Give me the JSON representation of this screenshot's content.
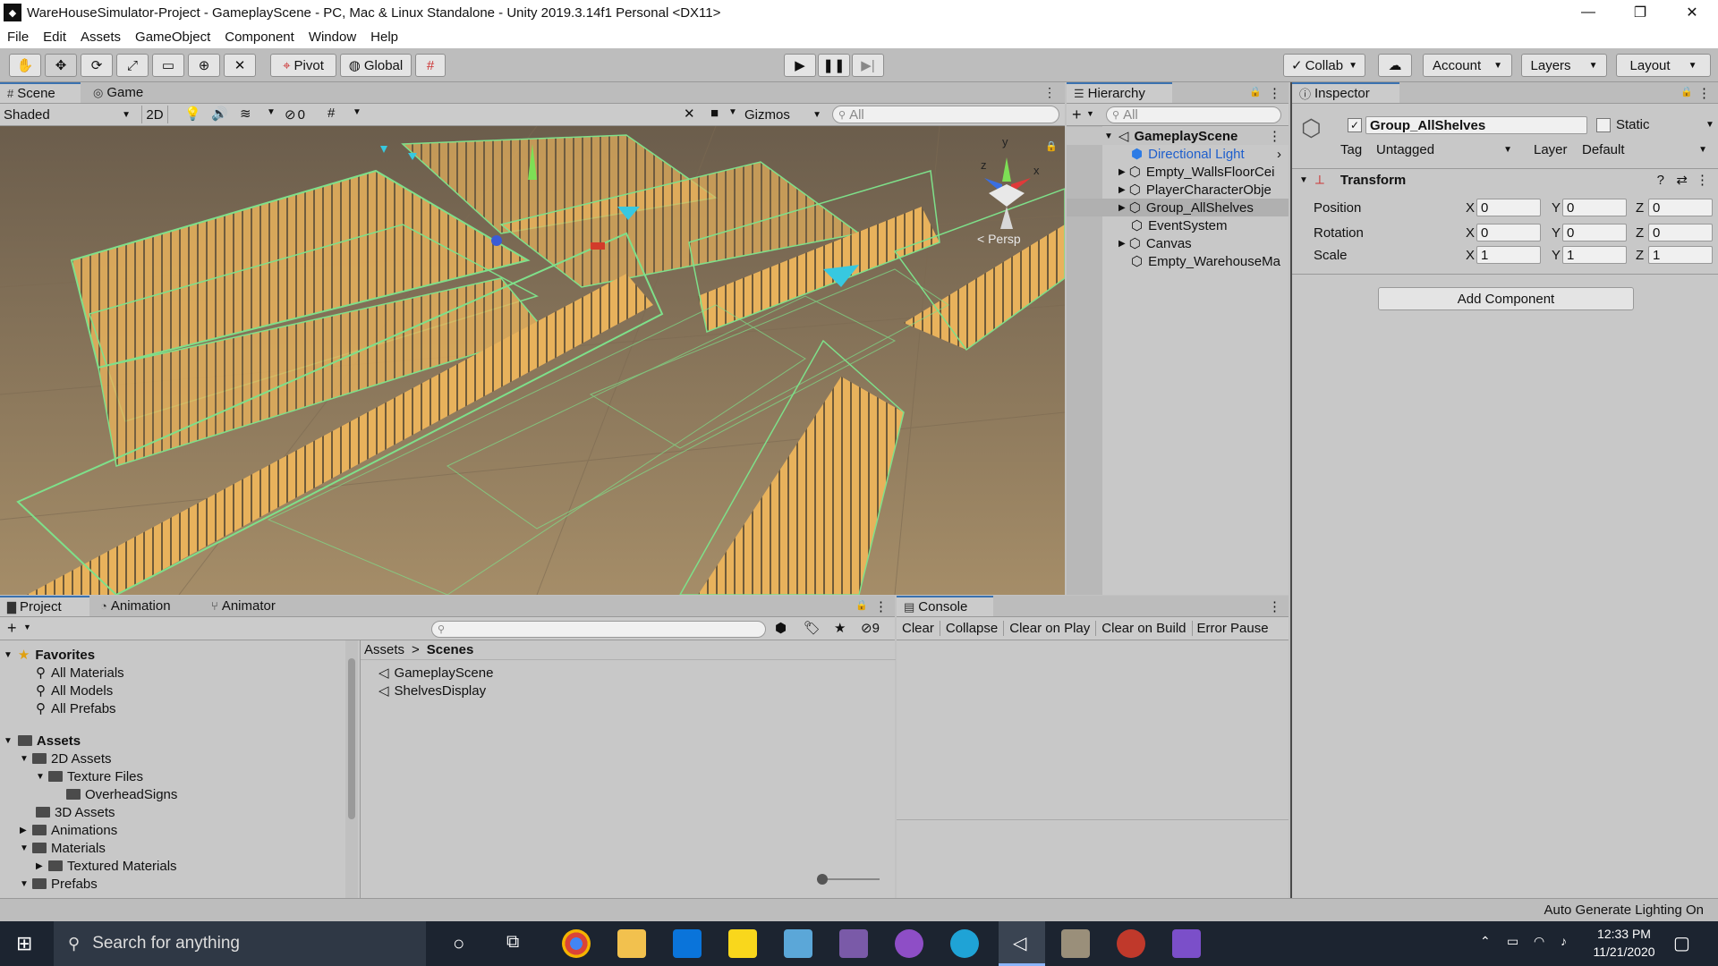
{
  "window": {
    "title": "WareHouseSimulator-Project - GameplayScene - PC, Mac & Linux Standalone - Unity 2019.3.14f1 Personal <DX11>",
    "min": "—",
    "restore": "❐",
    "close": "✕"
  },
  "menu": [
    "File",
    "Edit",
    "Assets",
    "GameObject",
    "Component",
    "Window",
    "Help"
  ],
  "toolbar": {
    "pivot": "Pivot",
    "global": "Global",
    "collab": "Collab",
    "account": "Account",
    "layers": "Layers",
    "layout": "Layout"
  },
  "scene": {
    "tab_scene": "Scene",
    "tab_game": "Game",
    "shading": "Shaded",
    "mode_2d": "2D",
    "hidden_count": "0",
    "gizmos": "Gizmos",
    "search_placeholder": "All",
    "persp": "< Persp",
    "axis_y": "y",
    "axis_x": "x",
    "axis_z": "z"
  },
  "hierarchy": {
    "title": "Hierarchy",
    "search_placeholder": "All",
    "scene_name": "GameplayScene",
    "items": [
      {
        "label": "Directional Light",
        "expandable": false,
        "selected_blue": true
      },
      {
        "label": "Empty_WallsFloorCei",
        "expandable": true
      },
      {
        "label": "PlayerCharacterObje",
        "expandable": true
      },
      {
        "label": "Group_AllShelves",
        "expandable": true,
        "selected": true
      },
      {
        "label": "EventSystem",
        "expandable": false
      },
      {
        "label": "Canvas",
        "expandable": true
      },
      {
        "label": "Empty_WarehouseMa",
        "expandable": false
      }
    ]
  },
  "inspector": {
    "title": "Inspector",
    "object_name": "Group_AllShelves",
    "static_label": "Static",
    "tag_label": "Tag",
    "tag_value": "Untagged",
    "layer_label": "Layer",
    "layer_value": "Default",
    "transform_title": "Transform",
    "position_label": "Position",
    "rotation_label": "Rotation",
    "scale_label": "Scale",
    "x": "X",
    "y": "Y",
    "z": "Z",
    "position": [
      "0",
      "0",
      "0"
    ],
    "rotation": [
      "0",
      "0",
      "0"
    ],
    "scale": [
      "1",
      "1",
      "1"
    ],
    "add_component": "Add Component"
  },
  "project": {
    "tab_project": "Project",
    "tab_animation": "Animation",
    "tab_animator": "Animator",
    "favorites": "Favorites",
    "fav_items": [
      "All Materials",
      "All Models",
      "All Prefabs"
    ],
    "assets_root": "Assets",
    "tree": [
      {
        "label": "2D Assets",
        "level": 1,
        "arrow": "▼"
      },
      {
        "label": "Texture Files",
        "level": 2,
        "arrow": "▼"
      },
      {
        "label": "OverheadSigns",
        "level": 3,
        "arrow": ""
      },
      {
        "label": "3D Assets",
        "level": 1,
        "arrow": ""
      },
      {
        "label": "Animations",
        "level": 1,
        "arrow": "▶"
      },
      {
        "label": "Materials",
        "level": 1,
        "arrow": "▼"
      },
      {
        "label": "Textured Materials",
        "level": 2,
        "arrow": "▶"
      },
      {
        "label": "Prefabs",
        "level": 1,
        "arrow": "▼"
      }
    ],
    "breadcrumb_root": "Assets",
    "breadcrumb_sep": ">",
    "breadcrumb_current": "Scenes",
    "files": [
      "GameplayScene",
      "ShelvesDisplay"
    ],
    "hidden_count": "9"
  },
  "console": {
    "title": "Console",
    "clear": "Clear",
    "collapse": "Collapse",
    "clear_on_play": "Clear on Play",
    "clear_on_build": "Clear on Build",
    "error_pause": "Error Pause"
  },
  "status": {
    "text": "Auto Generate Lighting On"
  },
  "taskbar": {
    "search": "Search for anything",
    "time": "12:33 PM",
    "date": "11/21/2020"
  }
}
